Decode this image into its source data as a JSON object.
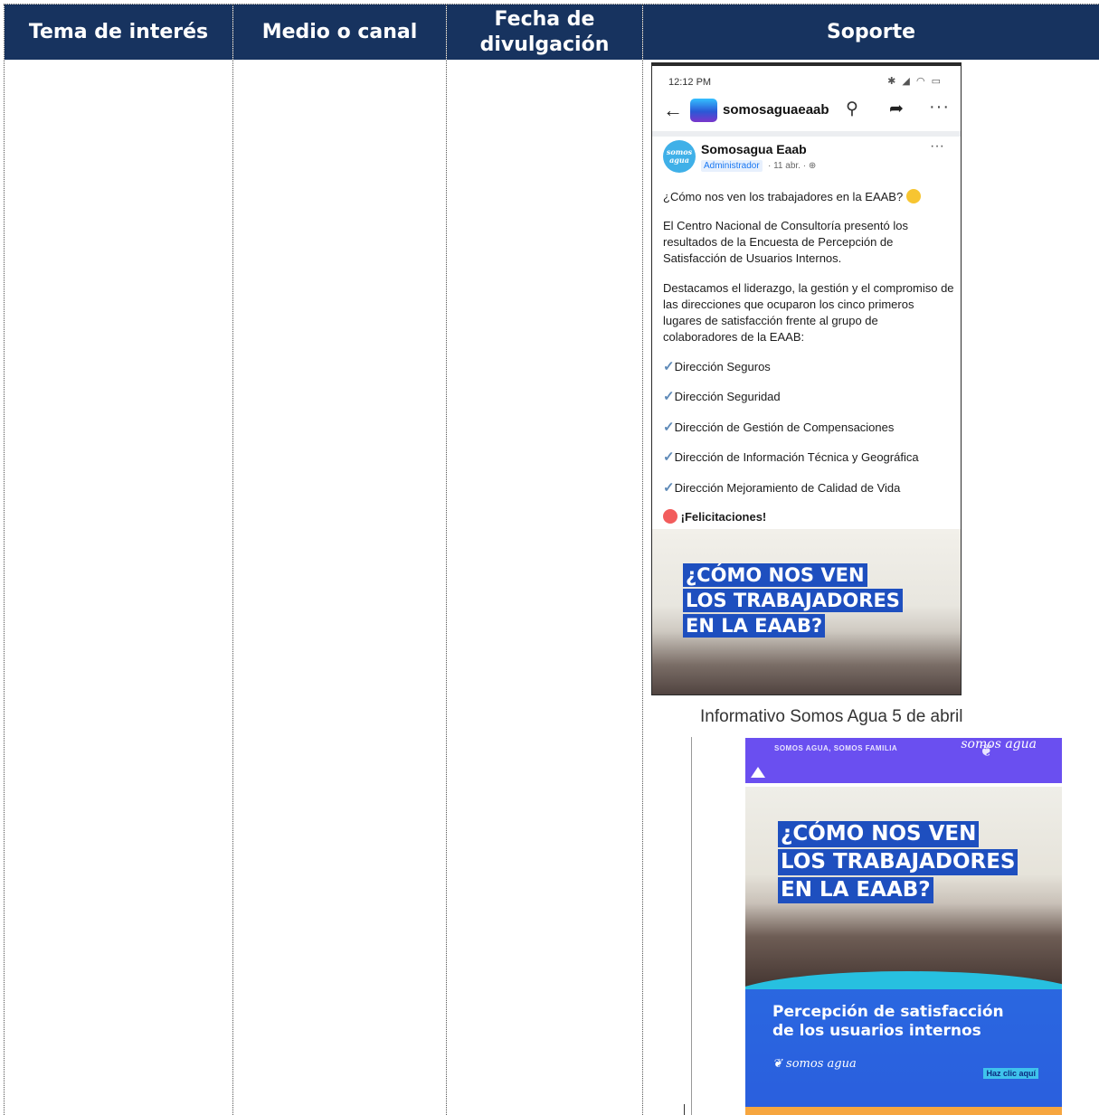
{
  "table": {
    "headers": [
      "Tema de interés",
      "Medio o canal",
      "Fecha de divulgación",
      "Soporte"
    ],
    "header_bg": "#17335f"
  },
  "phone_post": {
    "status_time": "12:12 PM",
    "page_name": "somosaguaeaab",
    "author": "Somosagua Eaab",
    "role": "Administrador",
    "meta": "· 11 abr. ·",
    "avatar_text": "somos agua",
    "question": "¿Cómo nos ven los trabajadores en la EAAB?",
    "paragraph1": "El Centro Nacional de Consultoría presentó los resultados de la Encuesta de Percepción de Satisfacción de Usuarios Internos.",
    "paragraph2": "Destacamos el liderazgo, la gestión y el compromiso de las direcciones que ocuparon los cinco primeros lugares de satisfacción frente al grupo de colaboradores de la EAAB:",
    "items": [
      "Dirección Seguros",
      "Dirección Seguridad",
      "Dirección de Gestión de Compensaciones",
      "Dirección de Información Técnica y Geográfica",
      "Dirección Mejoramiento de Calidad de Vida"
    ],
    "closing": "¡Felicitaciones!",
    "image_headline": [
      "¿CÓMO NOS VEN",
      "LOS TRABAJADORES",
      "EN LA EAAB?"
    ]
  },
  "newsletter": {
    "title": "Informativo Somos Agua 5 de abril",
    "tagline": "SOMOS AGUA, SOMOS FAMILIA",
    "logo_text": "somos agua",
    "headline": [
      "¿CÓMO NOS VEN",
      "LOS TRABAJADORES",
      "EN LA EAAB?"
    ],
    "subtitle": [
      "Percepción de satisfacción",
      "de los usuarios internos"
    ],
    "cta": "Haz clic aquí"
  }
}
